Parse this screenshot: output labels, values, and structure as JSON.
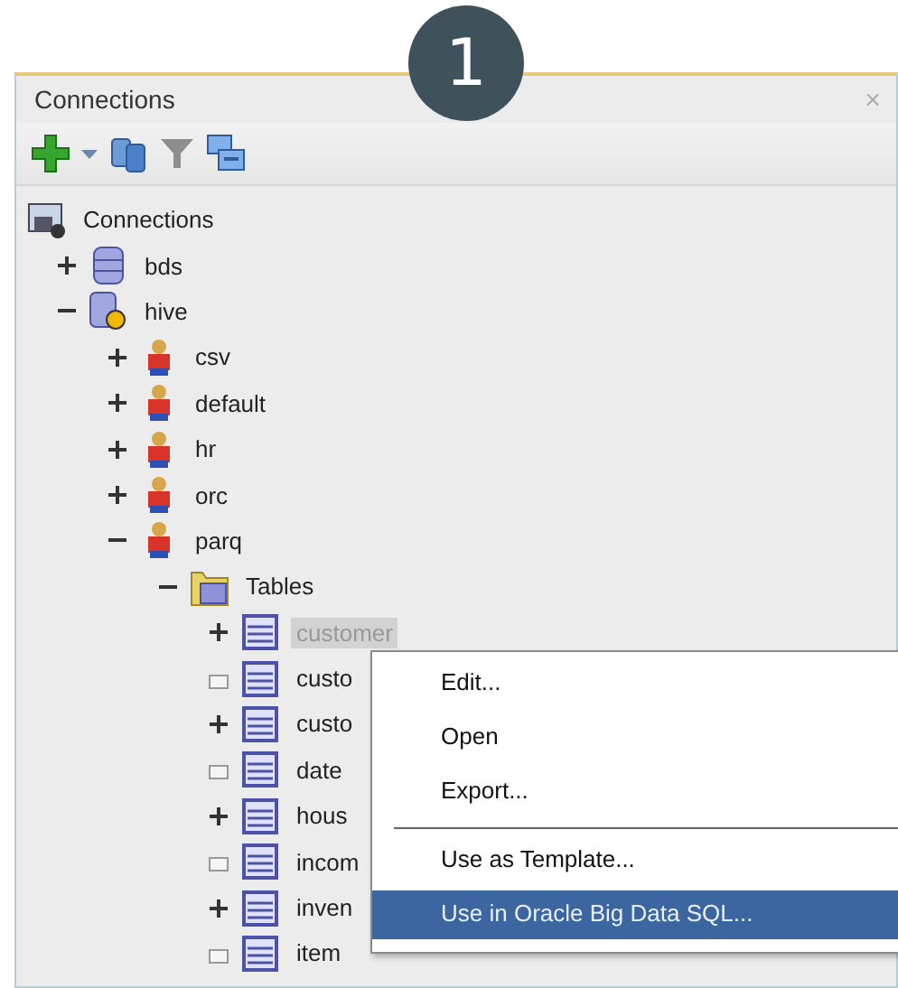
{
  "step_badge": "1",
  "panel": {
    "title": "Connections",
    "close": "×"
  },
  "toolbar": [
    {
      "kind": "add"
    },
    {
      "kind": "caret"
    },
    {
      "kind": "refresh"
    },
    {
      "kind": "filter"
    },
    {
      "kind": "collapse"
    }
  ],
  "tree": [
    {
      "label": "Connections",
      "kind": "root",
      "selected": false,
      "children": [
        {
          "label": "bds",
          "kind": "database",
          "expanded": false,
          "selected": false
        },
        {
          "label": "hive",
          "kind": "hive",
          "expanded": true,
          "selected": false,
          "children": [
            {
              "label": "csv",
              "kind": "schema",
              "expanded": false,
              "selected": false
            },
            {
              "label": "default",
              "kind": "schema",
              "expanded": false,
              "selected": false
            },
            {
              "label": "hr",
              "kind": "schema",
              "expanded": false,
              "selected": false
            },
            {
              "label": "orc",
              "kind": "schema",
              "expanded": false,
              "selected": false
            },
            {
              "label": "parq",
              "kind": "schema",
              "expanded": true,
              "selected": false,
              "children": [
                {
                  "label": "Tables",
                  "kind": "folder",
                  "expanded": true,
                  "selected": false,
                  "children": [
                    {
                      "label": "customer",
                      "kind": "table",
                      "expanded": false,
                      "selected": true
                    },
                    {
                      "label": "custo",
                      "kind": "table",
                      "selected": false
                    },
                    {
                      "label": "custo",
                      "kind": "table",
                      "expanded": false,
                      "selected": false
                    },
                    {
                      "label": "date",
                      "kind": "table",
                      "selected": false
                    },
                    {
                      "label": "hous",
                      "kind": "table",
                      "expanded": false,
                      "selected": false
                    },
                    {
                      "label": "incom",
                      "kind": "table",
                      "selected": false
                    },
                    {
                      "label": "inven",
                      "kind": "table",
                      "expanded": false,
                      "selected": false
                    },
                    {
                      "label": "item",
                      "kind": "table",
                      "selected": false
                    }
                  ]
                }
              ]
            }
          ]
        }
      ]
    }
  ],
  "context_menu": [
    {
      "label": "Edit...",
      "selected": false
    },
    {
      "label": "Open",
      "selected": false
    },
    {
      "label": "Export...",
      "selected": false
    },
    {
      "kind": "separator"
    },
    {
      "label": "Use as Template...",
      "selected": false
    },
    {
      "label": "Use in Oracle Big Data SQL...",
      "selected": true
    }
  ]
}
